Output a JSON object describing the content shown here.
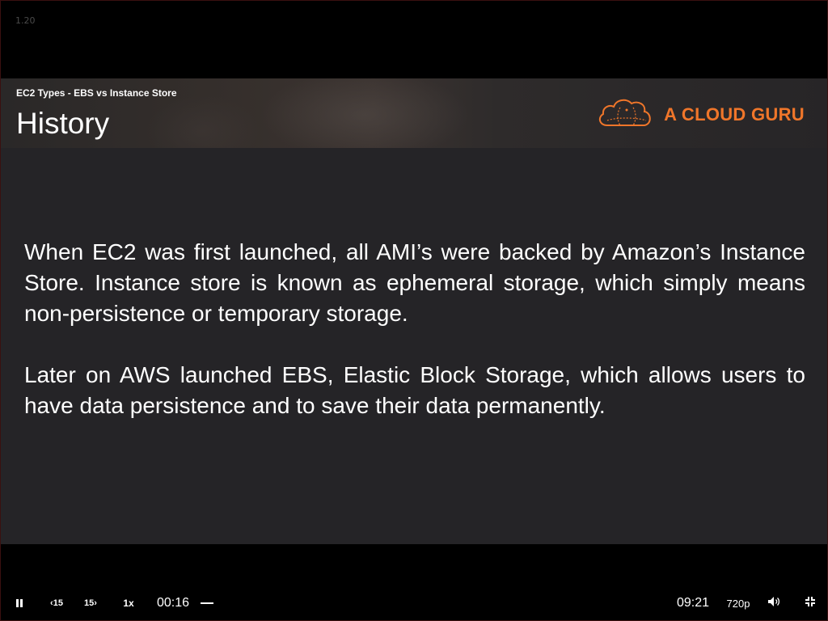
{
  "corner_label": "1.20",
  "slide": {
    "subtitle": "EC2 Types - EBS vs Instance Store",
    "title": "History",
    "logo_text": "A CLOUD GURU",
    "logo_icon": "cloud-logo-icon",
    "paragraphs": [
      "When EC2 was first launched, all AMI’s were backed by Amazon’s Instance Store. Instance store is known as ephemeral storage, which simply means non-persistence or temporary storage.",
      "Later on AWS launched EBS, Elastic Block Storage, which allows users to have data persistence and to save their data permanently."
    ]
  },
  "controls": {
    "pause_icon": "pause-icon",
    "back_label": "15",
    "forward_label": "15",
    "speed_label": "1x",
    "current_time": "00:16",
    "total_time": "09:21",
    "quality_label": "720p",
    "volume_icon": "volume-icon",
    "fullscreen_icon": "exit-fullscreen-icon"
  },
  "colors": {
    "accent": "#f0762a",
    "slide_bg": "#252427",
    "player_bg": "#000000"
  }
}
